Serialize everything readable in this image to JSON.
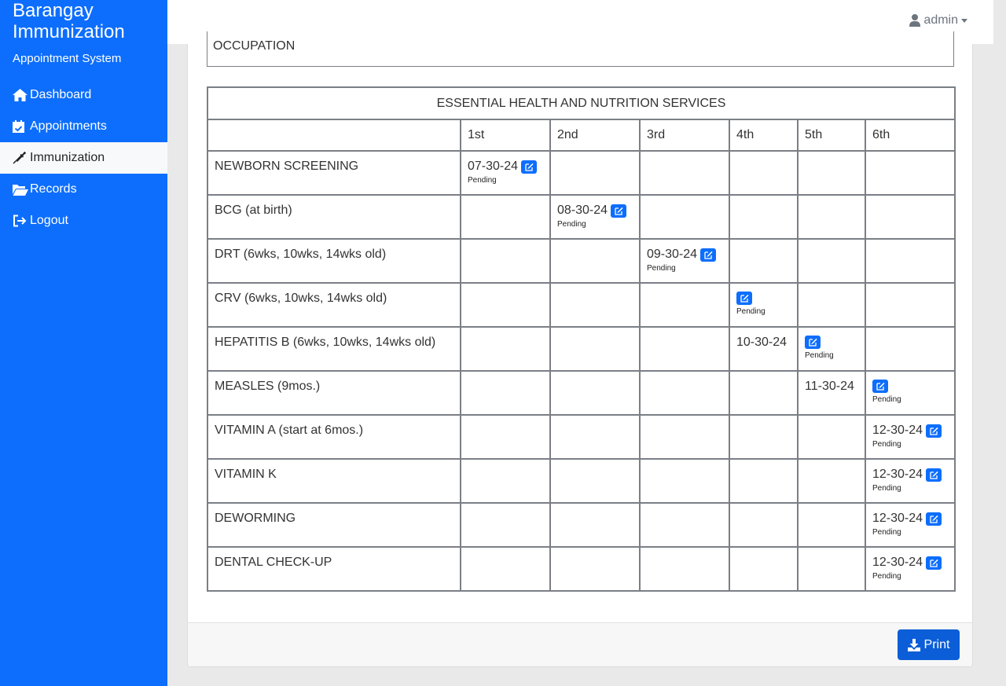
{
  "sidebar": {
    "brand_title_1": "Barangay",
    "brand_title_2": "Immunization",
    "brand_subtitle": "Appointment System",
    "items": [
      {
        "label": "Dashboard",
        "icon": "home-icon"
      },
      {
        "label": "Appointments",
        "icon": "calendar-check-icon"
      },
      {
        "label": "Immunization",
        "icon": "syringe-icon",
        "active": true
      },
      {
        "label": "Records",
        "icon": "folder-open-icon"
      },
      {
        "label": "Logout",
        "icon": "sign-out-icon"
      }
    ]
  },
  "topbar": {
    "user": "admin"
  },
  "form": {
    "occupation_label": "OCCUPATION"
  },
  "services_table": {
    "title": "ESSENTIAL HEALTH AND NUTRITION SERVICES",
    "columns": [
      "",
      "1st",
      "2nd",
      "3rd",
      "4th",
      "5th",
      "6th"
    ],
    "rows": [
      {
        "service": "NEWBORN SCREENING",
        "cells": [
          {
            "date": "07-30-24",
            "edit": true,
            "status": "Pending"
          },
          {},
          {},
          {},
          {},
          {}
        ]
      },
      {
        "service": "BCG (at birth)",
        "cells": [
          {},
          {
            "date": "08-30-24",
            "edit": true,
            "status": "Pending"
          },
          {},
          {},
          {},
          {}
        ]
      },
      {
        "service": "DRT (6wks, 10wks, 14wks old)",
        "cells": [
          {},
          {},
          {
            "date": "09-30-24",
            "edit": true,
            "status": "Pending"
          },
          {},
          {},
          {}
        ]
      },
      {
        "service": "CRV (6wks, 10wks, 14wks old)",
        "cells": [
          {},
          {},
          {},
          {
            "date": "",
            "edit": true,
            "status": "Pending"
          },
          {},
          {}
        ]
      },
      {
        "service": "HEPATITIS B (6wks, 10wks, 14wks old)",
        "cells": [
          {},
          {},
          {},
          {
            "date": "10-30-24"
          },
          {
            "date": "",
            "edit": true,
            "status": "Pending"
          },
          {}
        ]
      },
      {
        "service": "MEASLES (9mos.)",
        "cells": [
          {},
          {},
          {},
          {},
          {
            "date": "11-30-24"
          },
          {
            "date": "",
            "edit": true,
            "status": "Pending"
          }
        ]
      },
      {
        "service": "VITAMIN A (start at 6mos.)",
        "cells": [
          {},
          {},
          {},
          {},
          {},
          {
            "date": "12-30-24",
            "edit": true,
            "status": "Pending"
          }
        ]
      },
      {
        "service": "VITAMIN K",
        "cells": [
          {},
          {},
          {},
          {},
          {},
          {
            "date": "12-30-24",
            "edit": true,
            "status": "Pending"
          }
        ]
      },
      {
        "service": "DEWORMING",
        "cells": [
          {},
          {},
          {},
          {},
          {},
          {
            "date": "12-30-24",
            "edit": true,
            "status": "Pending"
          }
        ]
      },
      {
        "service": "DENTAL CHECK-UP",
        "cells": [
          {},
          {},
          {},
          {},
          {},
          {
            "date": "12-30-24",
            "edit": true,
            "status": "Pending"
          }
        ]
      }
    ]
  },
  "footer": {
    "print_label": "Print"
  },
  "colors": {
    "primary": "#0d6efd",
    "print_button": "#0b5ed7",
    "active_nav_bg": "#f8f9fa"
  }
}
